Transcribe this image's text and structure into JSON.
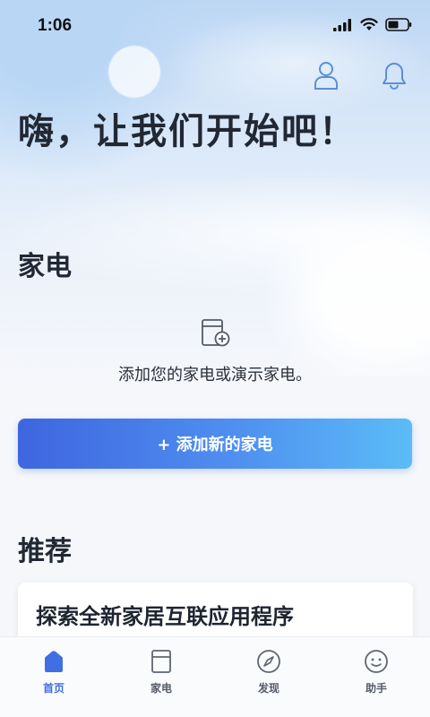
{
  "status_bar": {
    "time": "1:06"
  },
  "header": {
    "greeting": "嗨，让我们开始吧！"
  },
  "appliances": {
    "section_title": "家电",
    "empty_text": "添加您的家电或演示家电。",
    "add_button_label": "+ 添加新的家电"
  },
  "recommend": {
    "section_title": "推荐",
    "card_title": "探索全新家居互联应用程序"
  },
  "tabs": [
    {
      "label": "首页",
      "icon": "home-icon",
      "active": true
    },
    {
      "label": "家电",
      "icon": "appliance-icon",
      "active": false
    },
    {
      "label": "发现",
      "icon": "compass-icon",
      "active": false
    },
    {
      "label": "助手",
      "icon": "assistant-icon",
      "active": false
    }
  ],
  "colors": {
    "accent": "#3f6fe0",
    "button_start": "#3e66df",
    "button_end": "#5bbcf7"
  }
}
